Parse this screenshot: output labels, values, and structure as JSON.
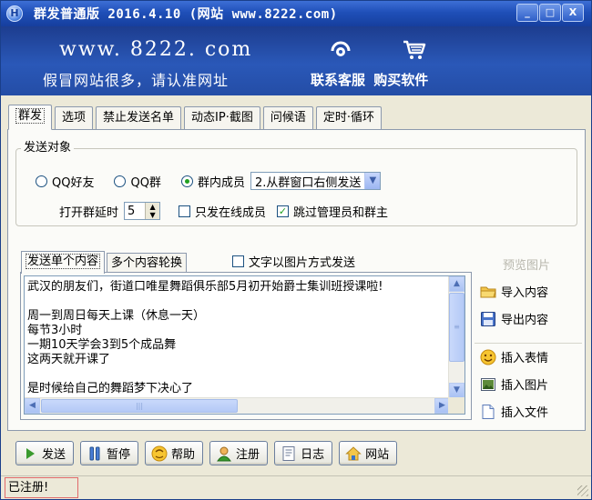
{
  "window": {
    "title": "群发普通版 2016.4.10  (网站 www.8222.com)",
    "buttons": {
      "minimize": "_",
      "maximize": "□",
      "close": "X"
    }
  },
  "banner": {
    "url": "www. 8222. com",
    "slogan": "假冒网站很多，请认准网址",
    "service_label": "联系客服",
    "buy_label": "购买软件"
  },
  "tabs": [
    "群发",
    "选项",
    "禁止发送名单",
    "动态IP·截图",
    "问候语",
    "定时·循环"
  ],
  "send_target": {
    "legend": "发送对象",
    "radio_options": [
      "QQ好友",
      "QQ群",
      "群内成员"
    ],
    "selected_option": "群内成员",
    "mode_select_value": "2.从群窗口右侧发送",
    "delay_label": "打开群延时",
    "delay_value": "5",
    "online_only_label": "只发在线成员",
    "online_only_checked": false,
    "skip_admin_label": "跳过管理员和群主",
    "skip_admin_checked": true
  },
  "content": {
    "tabs": [
      "发送单个内容",
      "多个内容轮换"
    ],
    "image_send_label": "文字以图片方式发送",
    "image_send_checked": false,
    "text": "武汉的朋友们，街道口唯星舞蹈俱乐部5月初开始爵士集训班授课啦!\n\n周一到周日每天上课（休息一天）\n每节3小时\n一期10天学会3到5个成品舞\n这两天就开课了\n\n是时候给自己的舞蹈梦下决心了"
  },
  "tools": {
    "preview": "预览图片",
    "import": "导入内容",
    "export": "导出内容",
    "emoji": "插入表情",
    "image": "插入图片",
    "file": "插入文件"
  },
  "bottom_buttons": {
    "send": "发送",
    "pause": "暂停",
    "help": "帮助",
    "register": "注册",
    "log": "日志",
    "website": "网站"
  },
  "status": {
    "text": "已注册!"
  },
  "colors": {
    "title_bar": "#1f4fb8",
    "banner": "#2a58b8",
    "panel": "#fbfbf8",
    "status_border": "#e06a6a"
  },
  "icons": {
    "app": "app-logo-icon",
    "service": "headset-icon",
    "cart": "cart-icon",
    "import": "folder-icon",
    "export": "save-icon",
    "emoji": "smiley-icon",
    "image": "picture-icon",
    "file": "document-icon",
    "send": "play-icon",
    "pause": "pause-icon",
    "help": "help-icon",
    "register": "user-icon",
    "log": "log-icon",
    "website": "home-icon"
  }
}
